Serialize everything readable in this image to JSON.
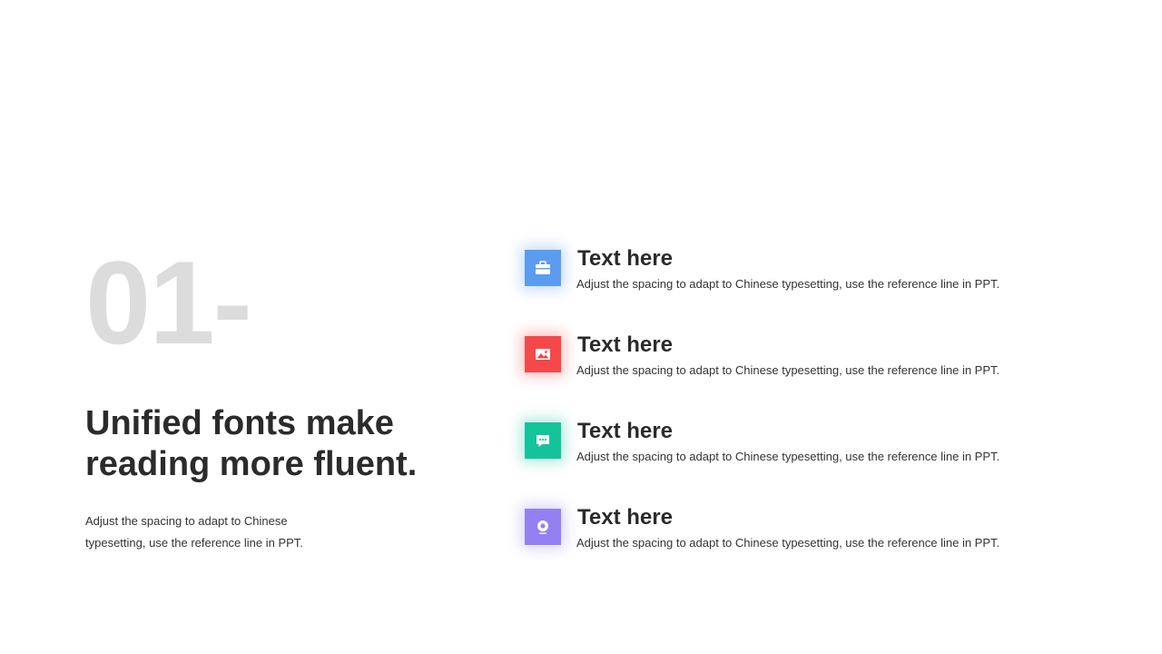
{
  "slide": {
    "number": "01-",
    "headline_line1": "Unified fonts make",
    "headline_line2": "reading more fluent.",
    "body_line1": "Adjust the spacing to adapt to Chinese",
    "body_line2": "typesetting, use the reference line in PPT."
  },
  "items": [
    {
      "icon": "briefcase-icon",
      "color": "#5b9cf0",
      "glow": "rgba(91,156,240,0.35)",
      "title": "Text here",
      "description": "Adjust the spacing to adapt to Chinese typesetting, use the reference line in PPT."
    },
    {
      "icon": "image-icon",
      "color": "#f5484a",
      "glow": "rgba(245,72,74,0.35)",
      "title": "Text here",
      "description": "Adjust the spacing to adapt to Chinese typesetting, use the reference line in PPT."
    },
    {
      "icon": "chat-icon",
      "color": "#15c39a",
      "glow": "rgba(21,195,154,0.35)",
      "title": "Text here",
      "description": "Adjust the spacing to adapt to Chinese typesetting, use the reference line in PPT."
    },
    {
      "icon": "location-pin-icon",
      "color": "#9580f2",
      "glow": "rgba(149,128,242,0.35)",
      "title": "Text here",
      "description": "Adjust the spacing to adapt to Chinese typesetting, use the reference line in PPT."
    }
  ]
}
